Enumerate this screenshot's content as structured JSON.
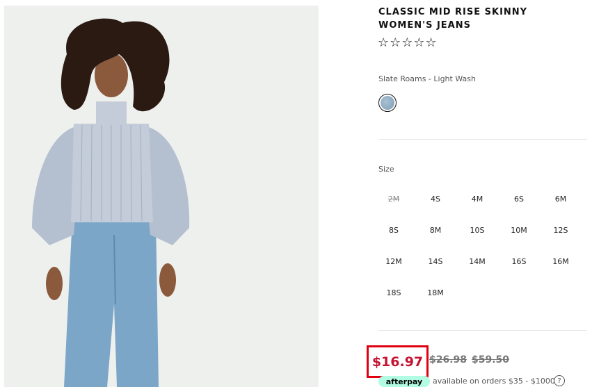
{
  "product": {
    "title": "CLASSIC MID RISE SKINNY WOMEN'S JEANS",
    "rating_stars": "☆☆☆☆☆",
    "color_name": "Slate Roams - Light Wash",
    "swatch_color": "#8fa9bd"
  },
  "sizes": {
    "label": "Size",
    "options": [
      {
        "label": "2M",
        "available": false
      },
      {
        "label": "4S",
        "available": true
      },
      {
        "label": "4M",
        "available": true
      },
      {
        "label": "6S",
        "available": true
      },
      {
        "label": "6M",
        "available": true
      },
      {
        "label": "8S",
        "available": true
      },
      {
        "label": "8M",
        "available": true
      },
      {
        "label": "10S",
        "available": true
      },
      {
        "label": "10M",
        "available": true
      },
      {
        "label": "12S",
        "available": true
      },
      {
        "label": "12M",
        "available": true
      },
      {
        "label": "14S",
        "available": true
      },
      {
        "label": "14M",
        "available": true
      },
      {
        "label": "16S",
        "available": true
      },
      {
        "label": "16M",
        "available": true
      },
      {
        "label": "18S",
        "available": true
      },
      {
        "label": "18M",
        "available": true
      }
    ]
  },
  "pricing": {
    "sale_price": "$16.97",
    "compare_price_1": "$26.98",
    "compare_price_2": "$59.50",
    "highlight_color": "#e0000f"
  },
  "afterpay": {
    "brand_label": "afterpay",
    "text": "available on orders $35 - $1000",
    "help_icon": "?"
  }
}
